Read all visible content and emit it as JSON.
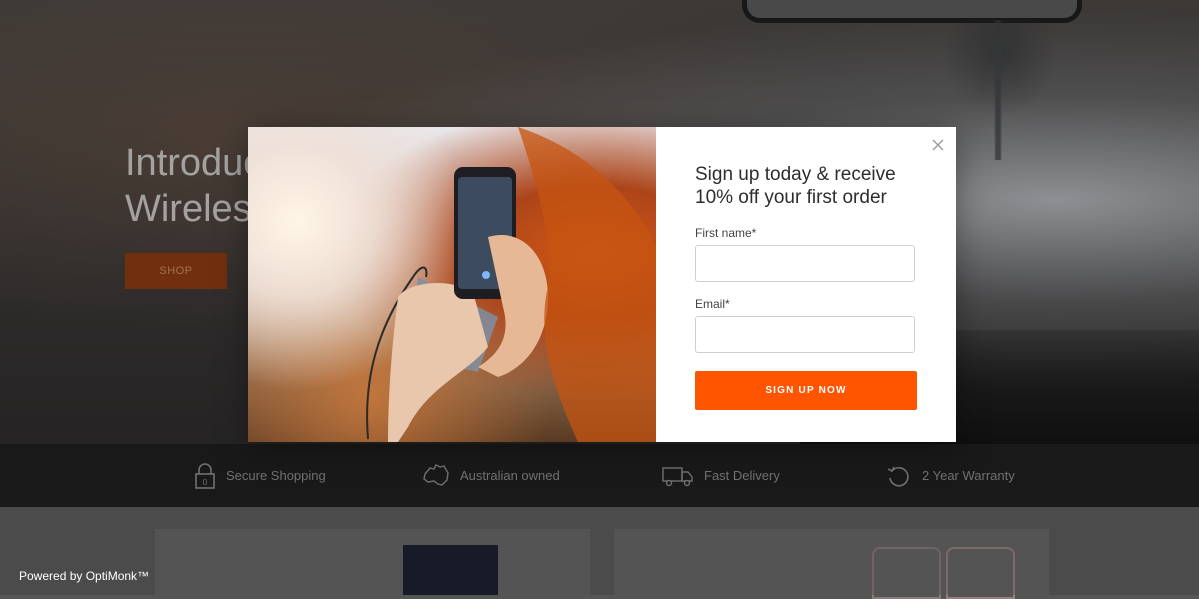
{
  "hero": {
    "title_line1": "Introduc",
    "title_line2": "Wireless",
    "shop_label": "SHOP"
  },
  "features": [
    {
      "label": "Secure Shopping",
      "icon": "lock-icon"
    },
    {
      "label": "Australian owned",
      "icon": "australia-map-icon"
    },
    {
      "label": "Fast Delivery",
      "icon": "delivery-truck-icon"
    },
    {
      "label": "2 Year Warranty",
      "icon": "warranty-circular-arrow-icon"
    }
  ],
  "popup": {
    "heading_line1": "Sign up today & receive",
    "heading_line2": "10% off your first order",
    "first_name_label": "First name*",
    "first_name_value": "",
    "email_label": "Email*",
    "email_value": "",
    "submit_label": "SIGN UP NOW",
    "close_icon": "close-icon"
  },
  "footer": {
    "powered_by": "Powered by OptiMonk™"
  },
  "colors": {
    "accent": "#ff5400",
    "features_bar": "#1f1f1f"
  }
}
